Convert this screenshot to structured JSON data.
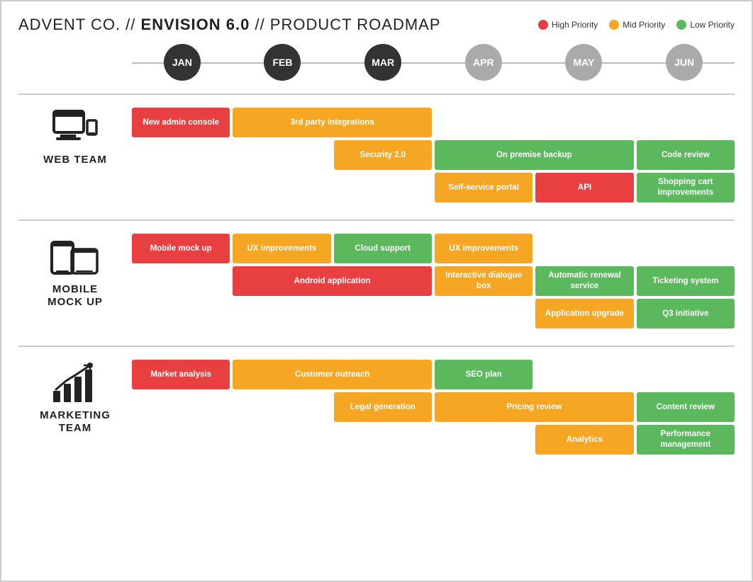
{
  "header": {
    "title_prefix": "ADVENT CO.  //  ",
    "title_bold": "ENVISION 6.0",
    "title_suffix": "  //  PRODUCT ROADMAP"
  },
  "legend": [
    {
      "label": "High Priority",
      "color": "#e84040"
    },
    {
      "label": "Mid Priority",
      "color": "#f5a623"
    },
    {
      "label": "Low Priority",
      "color": "#5cb85c"
    }
  ],
  "months": [
    "JAN",
    "FEB",
    "MAR",
    "APR",
    "MAY",
    "JUN"
  ],
  "teams": [
    {
      "name": "WEB TEAM",
      "rows": [
        [
          {
            "label": "New admin console",
            "color": "red",
            "col": 1,
            "span": 1
          },
          {
            "label": "3rd party integrations",
            "color": "orange",
            "col": 2,
            "span": 2
          }
        ],
        [
          {
            "label": "Security 2.0",
            "color": "orange",
            "col": 3,
            "span": 1
          },
          {
            "label": "On premise backup",
            "color": "green",
            "col": 4,
            "span": 2
          },
          {
            "label": "Code review",
            "color": "green",
            "col": 6,
            "span": 1
          }
        ],
        [
          {
            "label": "Self-service portal",
            "color": "orange",
            "col": 4,
            "span": 1
          },
          {
            "label": "API",
            "color": "red",
            "col": 5,
            "span": 1
          },
          {
            "label": "Shopping cart improvements",
            "color": "green",
            "col": 6,
            "span": 1
          }
        ]
      ]
    },
    {
      "name": "MOBILE MOCK UP",
      "rows": [
        [
          {
            "label": "Mobile mock up",
            "color": "red",
            "col": 1,
            "span": 1
          },
          {
            "label": "UX improvements",
            "color": "orange",
            "col": 2,
            "span": 1
          },
          {
            "label": "Cloud support",
            "color": "green",
            "col": 3,
            "span": 1
          },
          {
            "label": "UX improvements",
            "color": "orange",
            "col": 4,
            "span": 1
          }
        ],
        [
          {
            "label": "Android application",
            "color": "red",
            "col": 2,
            "span": 2
          },
          {
            "label": "Interactive dialogue box",
            "color": "orange",
            "col": 4,
            "span": 1
          },
          {
            "label": "Automatic renewal service",
            "color": "green",
            "col": 5,
            "span": 1
          },
          {
            "label": "Ticketing system",
            "color": "green",
            "col": 6,
            "span": 1
          }
        ],
        [
          {
            "label": "Application upgrade",
            "color": "orange",
            "col": 5,
            "span": 1
          },
          {
            "label": "Q3 initiative",
            "color": "green",
            "col": 6,
            "span": 1
          }
        ]
      ]
    },
    {
      "name": "MARKETING TEAM",
      "rows": [
        [
          {
            "label": "Market analysis",
            "color": "red",
            "col": 1,
            "span": 1
          },
          {
            "label": "Customer outreach",
            "color": "orange",
            "col": 2,
            "span": 2
          },
          {
            "label": "SEO plan",
            "color": "green",
            "col": 4,
            "span": 1
          }
        ],
        [
          {
            "label": "Legal generation",
            "color": "orange",
            "col": 3,
            "span": 1
          },
          {
            "label": "Pricing review",
            "color": "orange",
            "col": 4,
            "span": 2
          },
          {
            "label": "Content review",
            "color": "green",
            "col": 6,
            "span": 1
          }
        ],
        [
          {
            "label": "Analytics",
            "color": "orange",
            "col": 5,
            "span": 1
          },
          {
            "label": "Performance management",
            "color": "green",
            "col": 6,
            "span": 1
          }
        ]
      ]
    }
  ]
}
